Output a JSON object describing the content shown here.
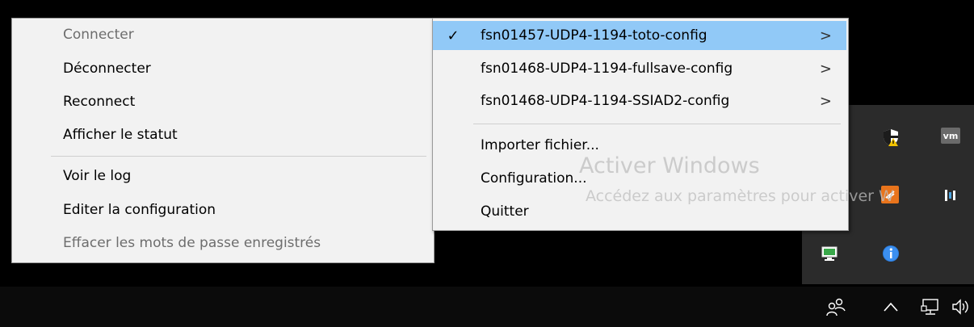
{
  "context_menu": {
    "items": [
      {
        "label": "Connecter",
        "enabled": false
      },
      {
        "label": "Déconnecter",
        "enabled": true
      },
      {
        "label": "Reconnect",
        "enabled": true
      },
      {
        "label": "Afficher le statut",
        "enabled": true
      },
      {
        "label": "Voir le log",
        "enabled": true
      },
      {
        "label": "Editer la configuration",
        "enabled": true
      },
      {
        "label": "Effacer les mots de passe enregistrés",
        "enabled": false
      }
    ]
  },
  "config_menu": {
    "configs": [
      {
        "label": "fsn01457-UDP4-1194-toto-config",
        "checked": true,
        "highlighted": true,
        "submenu_glyph": ">"
      },
      {
        "label": "fsn01468-UDP4-1194-fullsave-config",
        "checked": false,
        "highlighted": false,
        "submenu_glyph": ">"
      },
      {
        "label": "fsn01468-UDP4-1194-SSIAD2-config",
        "checked": false,
        "highlighted": false,
        "submenu_glyph": ">"
      }
    ],
    "check_glyph": "✓",
    "actions": [
      {
        "label": "Importer fichier..."
      },
      {
        "label": "Configuration..."
      },
      {
        "label": "Quitter"
      }
    ]
  },
  "watermark": {
    "title": "Activer Windows",
    "subtitle": "Accédez aux paramètres pour activer W"
  },
  "tray": {
    "icons": [
      "security-warning-icon",
      "vmware-icon",
      "app-orange-icon",
      "app-blue-bars-icon",
      "network-monitor-icon",
      "info-icon"
    ],
    "vm_label": "vm"
  },
  "taskbar": {
    "icons": [
      "people-icon",
      "chevron-up-icon",
      "network-icon",
      "volume-icon"
    ]
  },
  "colors": {
    "menu_bg": "#f2f2f2",
    "highlight": "#91c9f7",
    "disabled_text": "#6d6d6d",
    "tray_bg": "#2b2b2b"
  }
}
